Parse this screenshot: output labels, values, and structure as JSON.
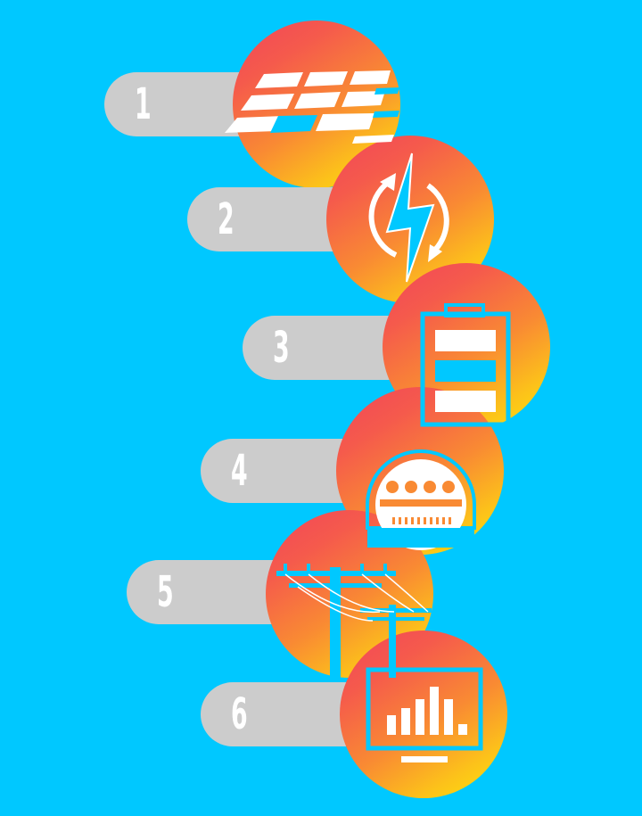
{
  "steps": [
    {
      "number": "1",
      "icon": "solar-panel-icon"
    },
    {
      "number": "2",
      "icon": "energy-cycle-icon"
    },
    {
      "number": "3",
      "icon": "battery-icon"
    },
    {
      "number": "4",
      "icon": "electric-meter-icon"
    },
    {
      "number": "5",
      "icon": "power-line-icon"
    },
    {
      "number": "6",
      "icon": "monitor-chart-icon"
    }
  ],
  "colors": {
    "background": "#00c8ff",
    "pill": "#cccccc",
    "number_text": "#ffffff",
    "gradient_start": "#f2455a",
    "gradient_end": "#fee50a",
    "icon_white": "#ffffff",
    "icon_cyan": "#00c8ff"
  }
}
